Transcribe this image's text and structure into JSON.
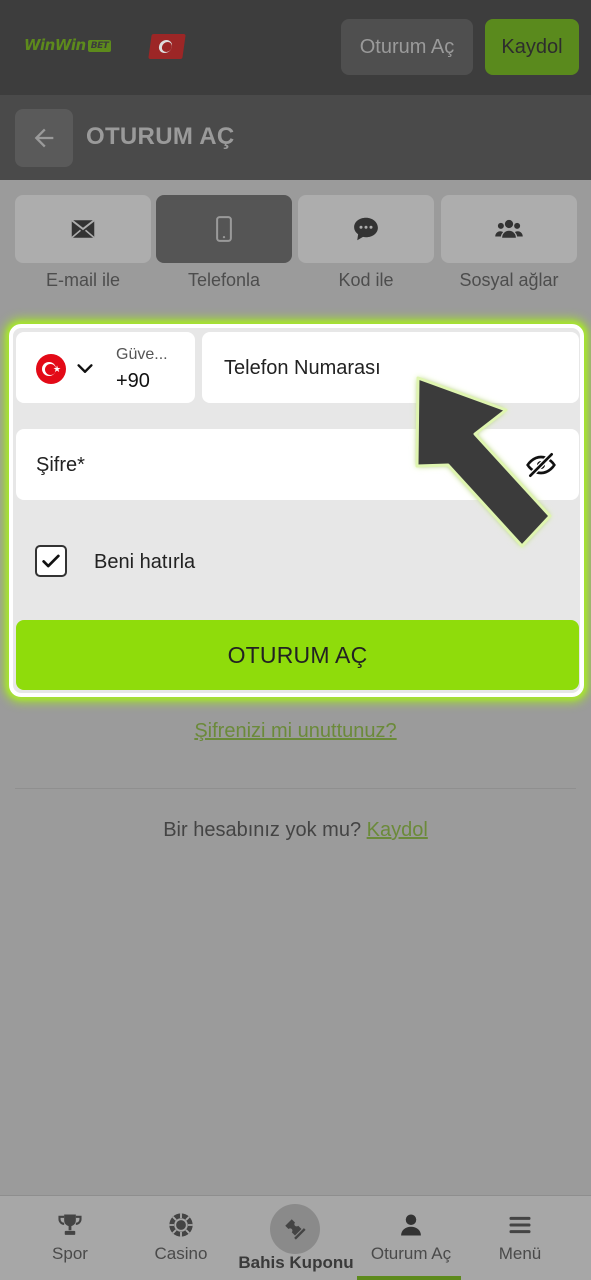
{
  "header": {
    "logo_text": "WinWin",
    "logo_badge": "BET",
    "login_label": "Oturum Aç",
    "register_label": "Kaydol"
  },
  "titlebar": {
    "title": "OTURUM AÇ"
  },
  "tabs": [
    {
      "label": "E-mail ile",
      "icon": "envelope-icon",
      "active": false
    },
    {
      "label": "Telefonla",
      "icon": "phone-icon",
      "active": true
    },
    {
      "label": "Kod ile",
      "icon": "chat-icon",
      "active": false
    },
    {
      "label": "Sosyal ağlar",
      "icon": "users-icon",
      "active": false
    }
  ],
  "form": {
    "country_name": "Güve...",
    "country_code": "+90",
    "phone_placeholder": "Telefon Numarası",
    "password_placeholder": "Şifre*",
    "remember_label": "Beni hatırla",
    "remember_checked": true,
    "submit_label": "OTURUM AÇ",
    "highlight_color": "#a3e22b"
  },
  "forgot_label": "Şifrenizi mi unuttunuz?",
  "no_account": {
    "text": "Bir hesabınız yok mu?",
    "link": "Kaydol"
  },
  "bottom_nav": [
    {
      "label": "Spor",
      "icon": "trophy-icon"
    },
    {
      "label": "Casino",
      "icon": "casino-chip-icon"
    },
    {
      "label": "Bahis Kuponu",
      "icon": "ticket-icon"
    },
    {
      "label": "Oturum Aç",
      "icon": "user-icon",
      "active": true
    },
    {
      "label": "Menü",
      "icon": "menu-icon"
    }
  ],
  "colors": {
    "accent_green": "#8fdc0b",
    "brand_green_dimmed": "#5d8a1c",
    "overlay_gray": "#9b9b9b"
  }
}
